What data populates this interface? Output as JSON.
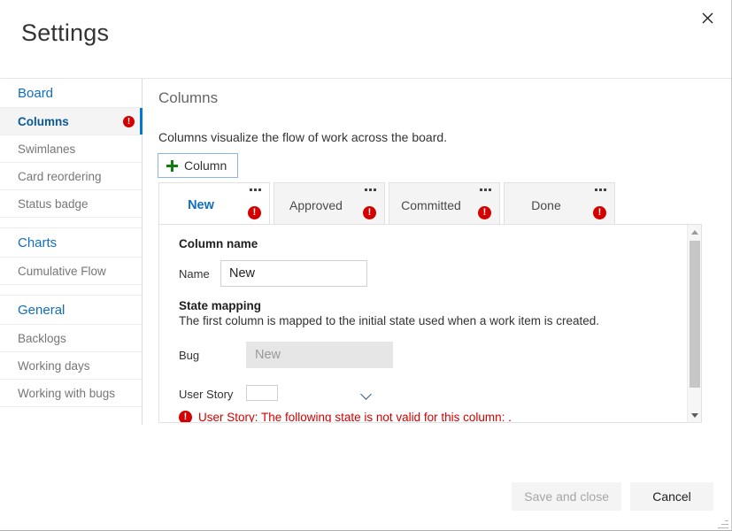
{
  "dialog": {
    "title": "Settings",
    "close_icon": "close-icon"
  },
  "sidebar": {
    "groups": [
      {
        "header": "Board",
        "items": [
          {
            "label": "Columns",
            "selected": true,
            "error": true,
            "error_icon": "error-circle-icon"
          },
          {
            "label": "Swimlanes",
            "selected": false,
            "error": false
          },
          {
            "label": "Card reordering",
            "selected": false,
            "error": false
          },
          {
            "label": "Status badge",
            "selected": false,
            "error": false
          }
        ]
      },
      {
        "header": "Charts",
        "items": [
          {
            "label": "Cumulative Flow",
            "selected": false,
            "error": false
          }
        ]
      },
      {
        "header": "General",
        "items": [
          {
            "label": "Backlogs",
            "selected": false,
            "error": false
          },
          {
            "label": "Working days",
            "selected": false,
            "error": false
          },
          {
            "label": "Working with bugs",
            "selected": false,
            "error": false
          }
        ]
      }
    ]
  },
  "main": {
    "title": "Columns",
    "description": "Columns visualize the flow of work across the board.",
    "add_column_label": "Column",
    "add_column_icon": "plus-icon",
    "tabs": [
      {
        "label": "New",
        "active": true,
        "error": true,
        "menu_icon": "ellipsis-icon",
        "error_icon": "error-circle-icon"
      },
      {
        "label": "Approved",
        "active": false,
        "error": true,
        "menu_icon": "ellipsis-icon",
        "error_icon": "error-circle-icon"
      },
      {
        "label": "Committed",
        "active": false,
        "error": true,
        "menu_icon": "ellipsis-icon",
        "error_icon": "error-circle-icon"
      },
      {
        "label": "Done",
        "active": false,
        "error": true,
        "menu_icon": "ellipsis-icon",
        "error_icon": "error-circle-icon"
      }
    ],
    "form": {
      "column_name_heading": "Column name",
      "name_label": "Name",
      "name_value": "New",
      "name_placeholder": "",
      "state_mapping_heading": "State mapping",
      "state_mapping_desc": "The first column is mapped to the initial state used when a work item is created.",
      "bug_label": "Bug",
      "bug_value": "New",
      "user_story_label": "User Story",
      "user_story_value": "",
      "user_story_chevron": "chevron-down-icon",
      "error_message": "User Story: The following state is not valid for this column: .",
      "error_icon": "error-circle-icon"
    },
    "scrollbar": {
      "up_icon": "scroll-up-arrow-icon",
      "down_icon": "scroll-down-arrow-icon"
    }
  },
  "footer": {
    "save_label": "Save and close",
    "cancel_label": "Cancel"
  },
  "colors": {
    "accent": "#0078d4",
    "link": "#106ebe",
    "error": "#d40000",
    "plus_green": "#107c10"
  }
}
